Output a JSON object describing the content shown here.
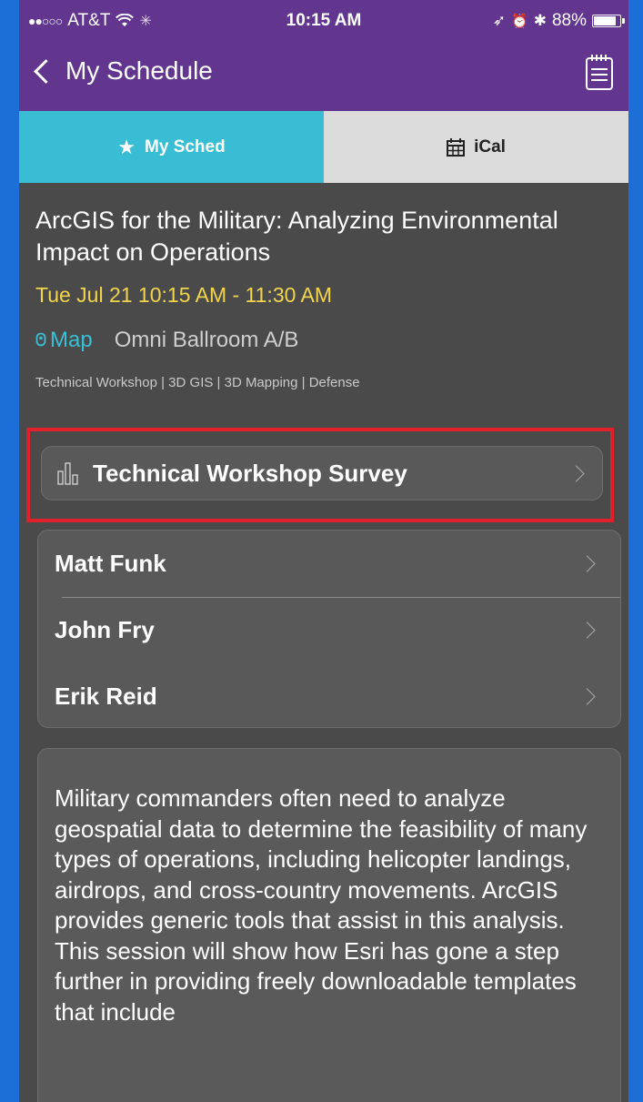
{
  "status_bar": {
    "carrier": "AT&T",
    "time": "10:15 AM",
    "battery": "88%",
    "battery_level": 0.88
  },
  "nav": {
    "back_label": "My Schedule"
  },
  "tabs": [
    {
      "label": "My Sched",
      "icon": "star-icon",
      "active": true
    },
    {
      "label": "iCal",
      "icon": "calendar-icon",
      "active": false
    }
  ],
  "session": {
    "title": "ArcGIS for the Military: Analyzing Environmental Impact on Operations",
    "time": "Tue Jul 21 10:15 AM - 11:30 AM",
    "map_label": "Map",
    "room": "Omni Ballroom A/B",
    "tags": "Technical Workshop | 3D GIS | 3D Mapping | Defense"
  },
  "survey": {
    "label": "Technical Workshop Survey"
  },
  "speakers": [
    {
      "name": "Matt Funk"
    },
    {
      "name": "John Fry"
    },
    {
      "name": "Erik Reid"
    }
  ],
  "description": "Military commanders often need to analyze geospatial data to determine the feasibility of many types of operations, including helicopter landings, airdrops, and cross-country movements. ArcGIS provides generic tools that assist in this analysis. This session will show how Esri has gone a step further in providing freely downloadable templates that include",
  "colors": {
    "nav_bg": "#62368f",
    "tab_active": "#39bdd4",
    "tab_inactive": "#dcdcdc",
    "time_accent": "#f2d54a",
    "link_accent": "#3bbfd6",
    "highlight_border": "#e0202a"
  }
}
